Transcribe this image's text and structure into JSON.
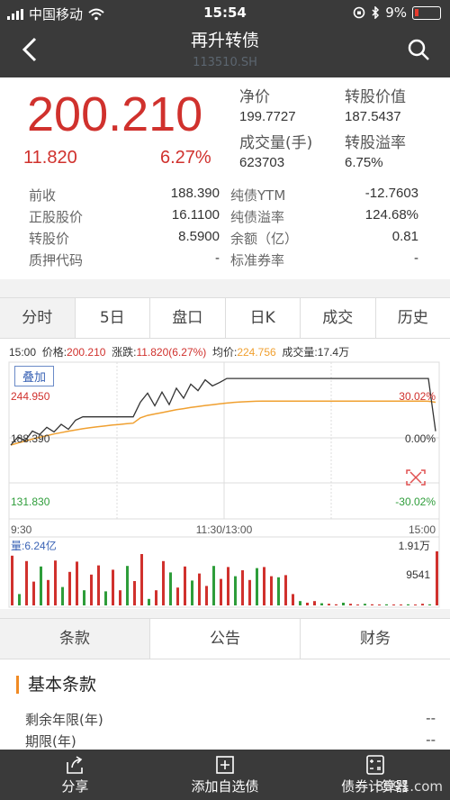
{
  "status": {
    "carrier": "中国移动",
    "time": "15:54",
    "battery": "9%"
  },
  "header": {
    "title": "再升转债",
    "code": "113510.SH"
  },
  "quote": {
    "price": "200.210",
    "change": "11.820",
    "change_pct": "6.27%",
    "stats": [
      {
        "label": "净价",
        "value": "199.7727"
      },
      {
        "label": "转股价值",
        "value": "187.5437"
      },
      {
        "label": "成交量(手)",
        "value": "623703"
      },
      {
        "label": "转股溢率",
        "value": "6.75%"
      }
    ],
    "grid": [
      {
        "l1": "前收",
        "v1": "188.390",
        "l2": "纯债YTM",
        "v2": "-12.7603"
      },
      {
        "l1": "正股股价",
        "v1": "16.1100",
        "l2": "纯债溢率",
        "v2": "124.68%"
      },
      {
        "l1": "转股价",
        "v1": "8.5900",
        "l2": "余额（亿）",
        "v2": "0.81"
      },
      {
        "l1": "质押代码",
        "v1": "-",
        "l2": "标准券率",
        "v2": "-"
      }
    ]
  },
  "tabs": [
    "分时",
    "5日",
    "盘口",
    "日K",
    "成交",
    "历史"
  ],
  "chart_info": {
    "time": "15:00",
    "price_label": "价格:",
    "price": "200.210",
    "chg_label": "涨跌:",
    "chg": "11.820(6.27%)",
    "avg_label": "均价:",
    "avg": "224.756",
    "vol_label": "成交量:",
    "vol": "17.4万",
    "overlay": "叠加"
  },
  "chart_data": {
    "type": "line",
    "y_high": "244.950",
    "y_mid": "188.390",
    "y_low": "131.830",
    "pct_high": "30.02%",
    "pct_mid": "0.00%",
    "pct_low": "-30.02%",
    "x_ticks": [
      "9:30",
      "11:30/13:00",
      "15:00"
    ],
    "volume_label": "量:6.24亿",
    "vol_high": "1.91万",
    "vol_mid": "9541",
    "ylim": [
      131.83,
      244.95
    ],
    "price_series": [
      188.4,
      195.2,
      192.1,
      200.3,
      197.4,
      203.5,
      199.6,
      206.0,
      201.8,
      209.5,
      212.4,
      212.4,
      212.4,
      212.4,
      212.4,
      212.4,
      212.4,
      212.4,
      224.9,
      232.5,
      221.8,
      233.4,
      222.8,
      236.7,
      228.2,
      240.1,
      234.6,
      243.8,
      238.7,
      241.5,
      244.95,
      244.95,
      244.95,
      244.95,
      244.95,
      244.95,
      244.95,
      244.95,
      244.95,
      244.95,
      244.95,
      244.95,
      244.95,
      244.95,
      244.95,
      244.95,
      244.95,
      244.95,
      244.95,
      244.95,
      244.95,
      244.95,
      244.95,
      244.95,
      244.95,
      244.95,
      244.95,
      244.95,
      244.95,
      200.21
    ],
    "avg_series": [
      188.4,
      190.2,
      191.8,
      193.5,
      195.0,
      196.4,
      197.8,
      199.0,
      200.2,
      201.2,
      202.3,
      203.1,
      203.9,
      204.6,
      205.3,
      205.9,
      206.5,
      207.0,
      211.5,
      213.6,
      214.8,
      216.0,
      217.2,
      218.4,
      219.3,
      220.3,
      221.2,
      222.0,
      222.7,
      223.4,
      224.1,
      224.7,
      225.1,
      225.4,
      225.6,
      225.7,
      225.7,
      225.7,
      225.7,
      225.7,
      225.7,
      225.7,
      225.7,
      225.7,
      225.7,
      225.7,
      225.7,
      225.7,
      225.7,
      225.7,
      225.7,
      225.7,
      225.7,
      225.7,
      225.7,
      225.7,
      225.7,
      225.7,
      225.6,
      224.76
    ],
    "volume_series": [
      0.92,
      0.21,
      0.82,
      0.44,
      0.72,
      0.47,
      0.83,
      0.34,
      0.62,
      0.81,
      0.28,
      0.57,
      0.74,
      0.26,
      0.66,
      0.28,
      0.73,
      0.45,
      0.95,
      0.12,
      0.28,
      0.82,
      0.61,
      0.33,
      0.72,
      0.46,
      0.59,
      0.36,
      0.73,
      0.49,
      0.71,
      0.54,
      0.65,
      0.47,
      0.69,
      0.71,
      0.54,
      0.52,
      0.56,
      0.21,
      0.08,
      0.05,
      0.08,
      0.04,
      0.03,
      0.02,
      0.05,
      0.03,
      0.01,
      0.03,
      0.02,
      0.01,
      0.02,
      0.01,
      0.01,
      0.02,
      0.01,
      0.03,
      0.02,
      1.0
    ]
  },
  "tabs2": [
    "条款",
    "公告",
    "财务"
  ],
  "terms": {
    "title": "基本条款",
    "items": [
      {
        "label": "剩余年限(年)",
        "value": "--"
      },
      {
        "label": "期限(年)",
        "value": "--"
      }
    ]
  },
  "bottom": {
    "share": "分享",
    "add": "添加自选债",
    "calc": "债券计算器"
  },
  "watermark": "8591.com",
  "colors": {
    "up": "#d0312d",
    "down": "#2e9d3a",
    "avg": "#f0a030",
    "price": "#333333"
  }
}
